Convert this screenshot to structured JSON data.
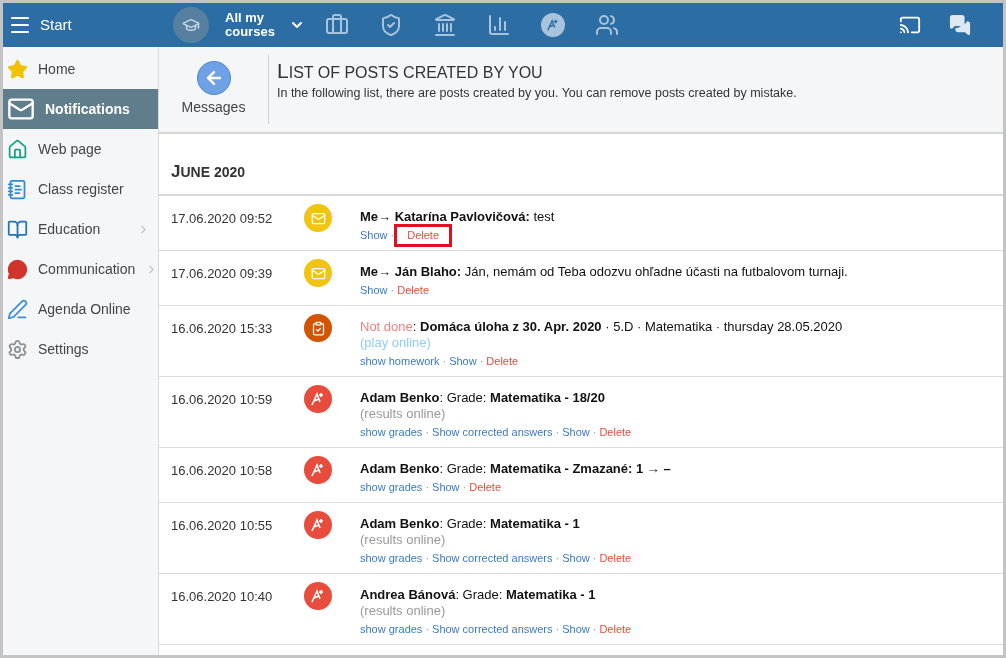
{
  "topbar": {
    "start": "Start",
    "courses": "All my courses"
  },
  "sidebar": {
    "items": [
      {
        "label": "Home",
        "selected": false,
        "expandable": false
      },
      {
        "label": "Notifications",
        "selected": true,
        "expandable": false
      },
      {
        "label": "Web page",
        "selected": false,
        "expandable": false
      },
      {
        "label": "Class register",
        "selected": false,
        "expandable": false
      },
      {
        "label": "Education",
        "selected": false,
        "expandable": true
      },
      {
        "label": "Communication",
        "selected": false,
        "expandable": true
      },
      {
        "label": "Agenda Online",
        "selected": false,
        "expandable": false
      },
      {
        "label": "Settings",
        "selected": false,
        "expandable": false
      }
    ]
  },
  "back": {
    "label": "Messages"
  },
  "page": {
    "title": "LIST OF POSTS CREATED BY YOU",
    "description": "In the following list, there are posts created by you. You can remove posts created by mistake."
  },
  "month": "JUNE 2020",
  "posts": [
    {
      "time": "17.06.2020 09:52",
      "kind": "message",
      "title": "**Me→ Katarína Pavlovičová:** test",
      "links": [
        {
          "label": "Show",
          "kind": "link",
          "highlighted": false
        },
        {
          "label": "·",
          "kind": "separator"
        },
        {
          "label": "Delete",
          "kind": "delete",
          "highlighted": true
        }
      ]
    },
    {
      "time": "17.06.2020 09:39",
      "kind": "message",
      "title": "**Me→ Ján Blaho:** Ján, nemám od Teba odozvu ohľadne účasti na futbalovom turnaji.",
      "links": [
        {
          "label": "Show",
          "kind": "link",
          "highlighted": false
        },
        {
          "label": "·",
          "kind": "separator"
        },
        {
          "label": "Delete",
          "kind": "delete",
          "highlighted": false
        }
      ]
    },
    {
      "time": "16.06.2020 15:33",
      "kind": "homework",
      "status": "Not done",
      "title": ": **Domáca úloha z 30. Apr. 2020** · 5.D · Matematika · thursday 28.05.2020",
      "note": {
        "text": "(play online)",
        "kind": "link"
      },
      "links": [
        {
          "label": "show homework",
          "kind": "link",
          "highlighted": false
        },
        {
          "label": "·",
          "kind": "separator"
        },
        {
          "label": "Show",
          "kind": "link",
          "highlighted": false
        },
        {
          "label": "·",
          "kind": "separator"
        },
        {
          "label": "Delete",
          "kind": "delete",
          "highlighted": false
        }
      ]
    },
    {
      "time": "16.06.2020 10:59",
      "kind": "grade",
      "title": "**Adam Benko**: Grade: **Matematika - 18/20**",
      "note": {
        "text": "(results online)",
        "kind": "muted"
      },
      "links": [
        {
          "label": "show grades",
          "kind": "link",
          "highlighted": false
        },
        {
          "label": "·",
          "kind": "separator"
        },
        {
          "label": "Show corrected answers",
          "kind": "link",
          "highlighted": false
        },
        {
          "label": "·",
          "kind": "separator"
        },
        {
          "label": "Show",
          "kind": "link",
          "highlighted": false
        },
        {
          "label": "·",
          "kind": "separator"
        },
        {
          "label": "Delete",
          "kind": "delete",
          "highlighted": false
        }
      ]
    },
    {
      "time": "16.06.2020 10:58",
      "kind": "grade",
      "title": "**Adam Benko**: Grade: **Matematika - Zmazané: 1 → –**",
      "links": [
        {
          "label": "show grades",
          "kind": "link",
          "highlighted": false
        },
        {
          "label": "·",
          "kind": "separator"
        },
        {
          "label": "Show",
          "kind": "link",
          "highlighted": false
        },
        {
          "label": "·",
          "kind": "separator"
        },
        {
          "label": "Delete",
          "kind": "delete",
          "highlighted": false
        }
      ]
    },
    {
      "time": "16.06.2020 10:55",
      "kind": "grade",
      "title": "**Adam Benko**: Grade: **Matematika - 1**",
      "note": {
        "text": "(results online)",
        "kind": "muted"
      },
      "links": [
        {
          "label": "show grades",
          "kind": "link",
          "highlighted": false
        },
        {
          "label": "·",
          "kind": "separator"
        },
        {
          "label": "Show corrected answers",
          "kind": "link",
          "highlighted": false
        },
        {
          "label": "·",
          "kind": "separator"
        },
        {
          "label": "Show",
          "kind": "link",
          "highlighted": false
        },
        {
          "label": "·",
          "kind": "separator"
        },
        {
          "label": "Delete",
          "kind": "delete",
          "highlighted": false
        }
      ]
    },
    {
      "time": "16.06.2020 10:40",
      "kind": "grade",
      "title": "**Andrea Bánová**: Grade: **Matematika - 1**",
      "note": {
        "text": "(results online)",
        "kind": "muted"
      },
      "links": [
        {
          "label": "show grades",
          "kind": "link",
          "highlighted": false
        },
        {
          "label": "·",
          "kind": "separator"
        },
        {
          "label": "Show corrected answers",
          "kind": "link",
          "highlighted": false
        },
        {
          "label": "·",
          "kind": "separator"
        },
        {
          "label": "Show",
          "kind": "link",
          "highlighted": false
        },
        {
          "label": "·",
          "kind": "separator"
        },
        {
          "label": "Delete",
          "kind": "delete",
          "highlighted": false
        }
      ]
    }
  ]
}
